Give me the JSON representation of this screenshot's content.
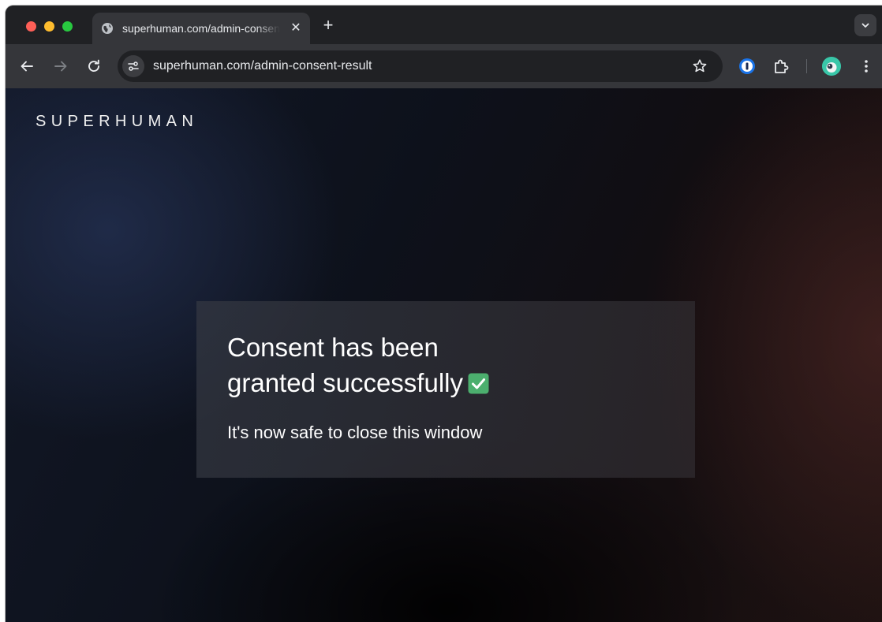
{
  "browser": {
    "tab": {
      "title": "superhuman.com/admin-consent-result",
      "favicon": "globe-icon"
    },
    "address_bar": {
      "url": "superhuman.com/admin-consent-result"
    },
    "extensions": [
      "1password-icon",
      "puzzle-icon"
    ]
  },
  "page": {
    "brand": "SUPERHUMAN",
    "card": {
      "title_line1": "Consent has been",
      "title_line2": "granted successfully",
      "sub": "It's now safe to close this window",
      "status_icon": "check-mark-button-icon"
    }
  },
  "colors": {
    "check_green": "#4caf6e",
    "tab_active": "#35363a",
    "chrome_bg": "#202124"
  }
}
